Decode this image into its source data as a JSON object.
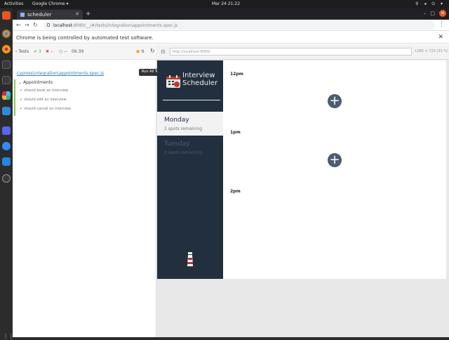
{
  "os": {
    "activities": "Activities",
    "app_menu": "Google Chrome ▾",
    "clock": "Mar 24  21:22",
    "tray": "⚲ ◂ ⏻ ▾"
  },
  "browser": {
    "tab_title": "scheduler",
    "address_host": "localhost",
    "address_path": ":8080/__/#/tests/integration\\appointments.spec.js",
    "infobar": "Chrome is being controlled by automated test software."
  },
  "runner": {
    "tests_button": "Tests",
    "passed": "3",
    "failed": "--",
    "pending": "--",
    "duration": "06.39",
    "spec_path": "cypress\\integration\\appointments.spec.js",
    "tooltip": "Run All Tests",
    "tooltip_key": "R",
    "suite_title": "Appointments",
    "tests": [
      "should book an interview",
      "should edit an interview",
      "should cancel an interview"
    ],
    "aut_url": "http://localhost:8000/",
    "viewport": "1280 × 720  (33 %)"
  },
  "app": {
    "logo_text_1": "Interview",
    "logo_text_2": "Scheduler",
    "days": [
      {
        "name": "Monday",
        "spots": "2 spots remaining"
      },
      {
        "name": "Tuesday",
        "spots": "2 spots remaining"
      }
    ],
    "slots": [
      "12pm",
      "1pm",
      "2pm"
    ]
  },
  "colors": {
    "sidebar_bg": "#222f3e",
    "cypress_pass": "#8cc84b",
    "ubuntu_orange": "#e95420"
  }
}
